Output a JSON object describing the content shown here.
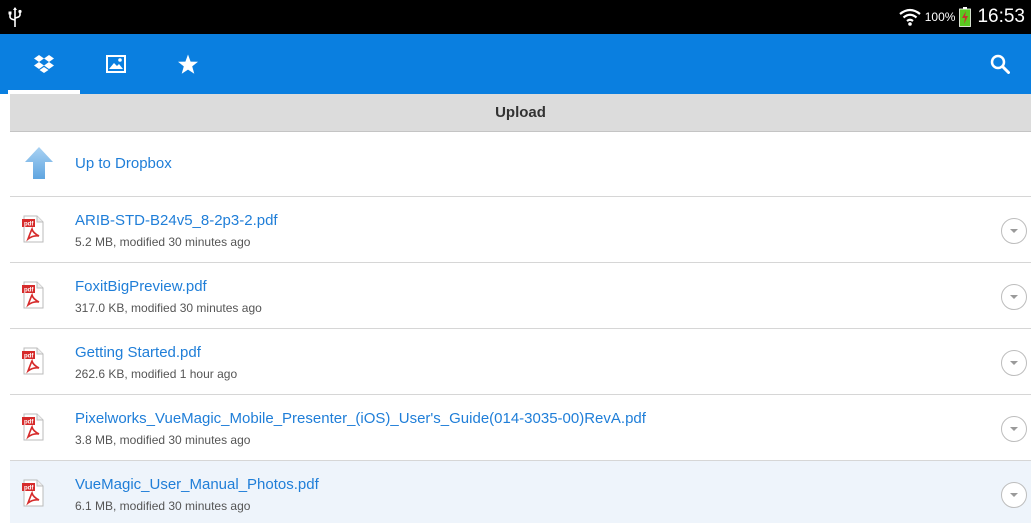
{
  "status_bar": {
    "battery_percent": "100%",
    "time": "16:53",
    "icons": [
      "usb-icon",
      "wifi-icon",
      "battery-charging-icon"
    ]
  },
  "action_bar": {
    "tabs": [
      {
        "name": "dropbox",
        "icon": "dropbox-icon",
        "active": true
      },
      {
        "name": "photos",
        "icon": "image-icon",
        "active": false
      },
      {
        "name": "favorites",
        "icon": "star-icon",
        "active": false
      }
    ],
    "search_icon": "search-icon",
    "color": "#0a7fe0"
  },
  "upload": {
    "label": "Upload"
  },
  "parent": {
    "label": "Up to Dropbox"
  },
  "files": [
    {
      "name": "ARIB-STD-B24v5_8-2p3-2.pdf",
      "meta": "5.2 MB, modified 30 minutes ago"
    },
    {
      "name": "FoxitBigPreview.pdf",
      "meta": "317.0 KB, modified 30 minutes ago"
    },
    {
      "name": "Getting Started.pdf",
      "meta": "262.6 KB, modified 1 hour ago"
    },
    {
      "name": "Pixelworks_VueMagic_Mobile_Presenter_(iOS)_User's_Guide(014-3035-00)RevA.pdf",
      "meta": "3.8 MB, modified 30 minutes ago"
    },
    {
      "name": "VueMagic_User_Manual_Photos.pdf",
      "meta": "6.1 MB, modified 30 minutes ago"
    }
  ]
}
